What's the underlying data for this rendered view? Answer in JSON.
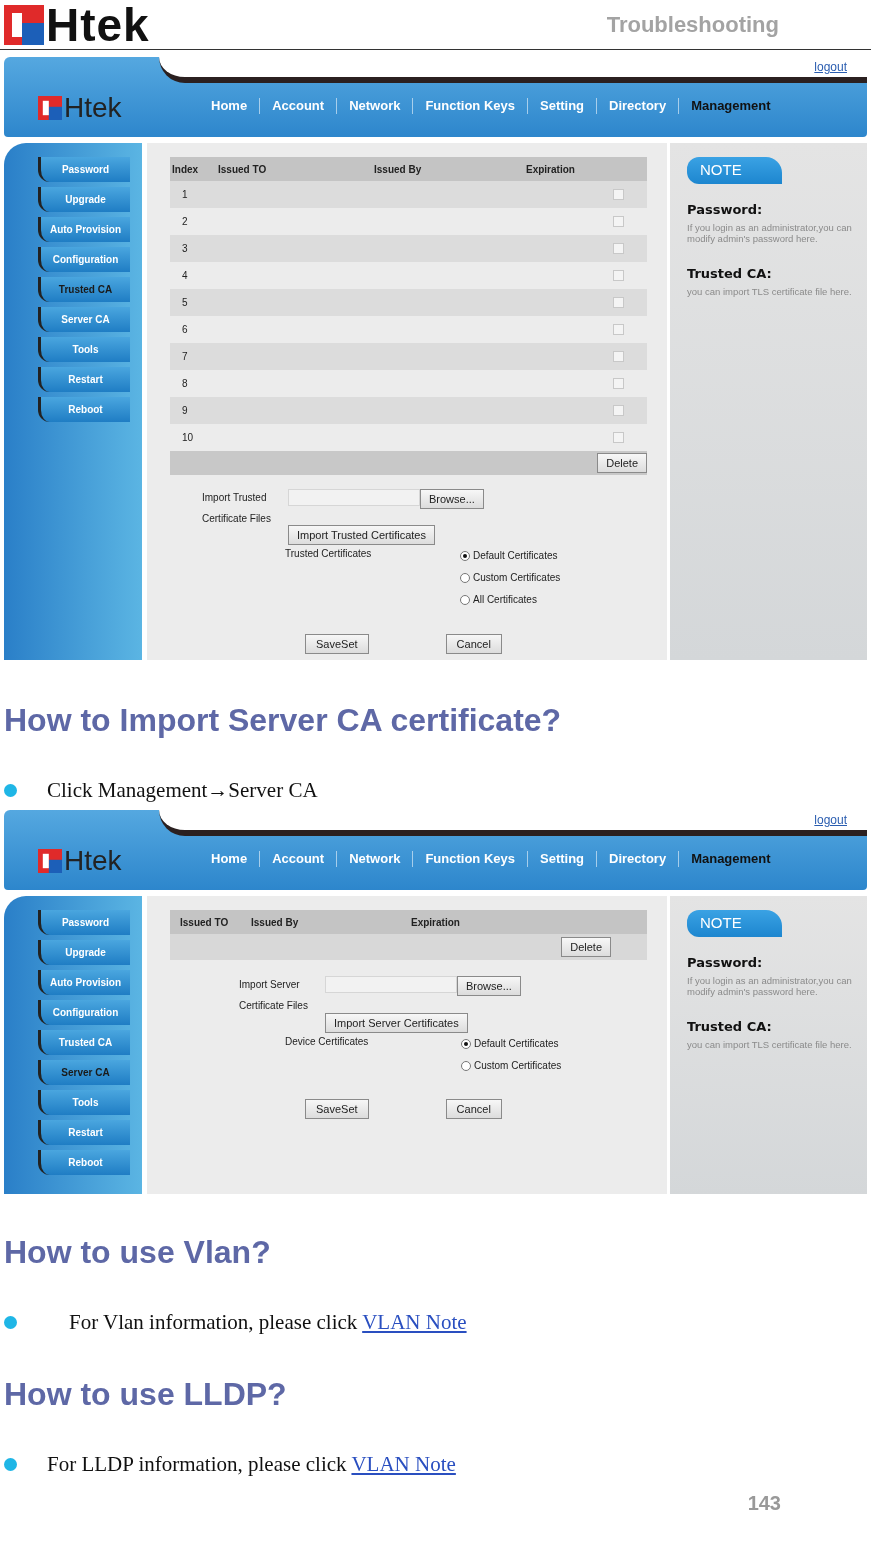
{
  "page_header": {
    "logo": "Htek",
    "section": "Troubleshooting"
  },
  "blocks": [
    {
      "kind": "screenshot",
      "logo": "Htek",
      "logout": "logout",
      "nav": [
        {
          "label": "Home",
          "selected": false
        },
        {
          "label": "Account",
          "selected": false
        },
        {
          "label": "Network",
          "selected": false
        },
        {
          "label": "Function Keys",
          "selected": false
        },
        {
          "label": "Setting",
          "selected": false
        },
        {
          "label": "Directory",
          "selected": false
        },
        {
          "label": "Management",
          "selected": true
        }
      ],
      "sidebar": [
        {
          "label": "Password",
          "selected": false
        },
        {
          "label": "Upgrade",
          "selected": false
        },
        {
          "label": "Auto Provision",
          "selected": false
        },
        {
          "label": "Configuration",
          "selected": false
        },
        {
          "label": "Trusted CA",
          "selected": true
        },
        {
          "label": "Server CA",
          "selected": false
        },
        {
          "label": "Tools",
          "selected": false
        },
        {
          "label": "Restart",
          "selected": false
        },
        {
          "label": "Reboot",
          "selected": false
        }
      ],
      "table": {
        "columns": [
          "Index",
          "Issued TO",
          "Issued By",
          "Expiration"
        ],
        "rows": [
          {
            "index": "1",
            "checked": false
          },
          {
            "index": "2",
            "checked": false
          },
          {
            "index": "3",
            "checked": false
          },
          {
            "index": "4",
            "checked": false
          },
          {
            "index": "5",
            "checked": false
          },
          {
            "index": "6",
            "checked": false
          },
          {
            "index": "7",
            "checked": false
          },
          {
            "index": "8",
            "checked": false
          },
          {
            "index": "9",
            "checked": false
          },
          {
            "index": "10",
            "checked": false
          }
        ],
        "delete": "Delete"
      },
      "import_label": "Import Trusted Certificate Files",
      "browse": "Browse...",
      "import_button": "Import Trusted Certificates",
      "cert_label": "Trusted Certificates",
      "options": [
        {
          "label": "Default Certificates",
          "selected": true
        },
        {
          "label": "Custom Certificates",
          "selected": false
        },
        {
          "label": "All Certificates",
          "selected": false
        }
      ],
      "buttons": [
        "SaveSet",
        "Cancel"
      ],
      "note": {
        "title": "NOTE",
        "items": [
          {
            "title": "Password:",
            "text": "If you login as an administrator,you can modify admin's password here."
          },
          {
            "title": "Trusted CA:",
            "text": "you can import TLS certificate file here."
          }
        ]
      }
    },
    {
      "kind": "heading",
      "text": "How to Import Server CA certificate?"
    },
    {
      "kind": "bullet",
      "text": "Click Management→Server CA"
    },
    {
      "kind": "screenshot",
      "logo": "Htek",
      "logout": "logout",
      "nav": [
        {
          "label": "Home",
          "selected": false
        },
        {
          "label": "Account",
          "selected": false
        },
        {
          "label": "Network",
          "selected": false
        },
        {
          "label": "Function Keys",
          "selected": false
        },
        {
          "label": "Setting",
          "selected": false
        },
        {
          "label": "Directory",
          "selected": false
        },
        {
          "label": "Management",
          "selected": true
        }
      ],
      "sidebar": [
        {
          "label": "Password",
          "selected": false
        },
        {
          "label": "Upgrade",
          "selected": false
        },
        {
          "label": "Auto Provision",
          "selected": false
        },
        {
          "label": "Configuration",
          "selected": false
        },
        {
          "label": "Trusted CA",
          "selected": false
        },
        {
          "label": "Server CA",
          "selected": true
        },
        {
          "label": "Tools",
          "selected": false
        },
        {
          "label": "Restart",
          "selected": false
        },
        {
          "label": "Reboot",
          "selected": false
        }
      ],
      "table": {
        "columns": [
          "Issued TO",
          "Issued By",
          "Expiration"
        ],
        "delete": "Delete"
      },
      "import_label": "Import Server Certificate Files",
      "browse": "Browse...",
      "import_button": "Import Server Certificates",
      "cert_label": "Device Certificates",
      "options": [
        {
          "label": "Default Certificates",
          "selected": true
        },
        {
          "label": "Custom Certificates",
          "selected": false
        }
      ],
      "buttons": [
        "SaveSet",
        "Cancel"
      ],
      "note": {
        "title": "NOTE",
        "items": [
          {
            "title": "Password:",
            "text": "If you login as an administrator,you can modify admin's password here."
          },
          {
            "title": "Trusted CA:",
            "text": "you can import TLS certificate file here."
          }
        ]
      }
    },
    {
      "kind": "heading",
      "text": "How to use Vlan?"
    },
    {
      "kind": "indented_bullet",
      "text": "For Vlan information, please click",
      "link": "VLAN Note"
    },
    {
      "kind": "heading",
      "text": "How to use LLDP?"
    },
    {
      "kind": "bullet",
      "text": "For LLDP information, please click",
      "link": "VLAN Note"
    }
  ],
  "page_number": "143"
}
